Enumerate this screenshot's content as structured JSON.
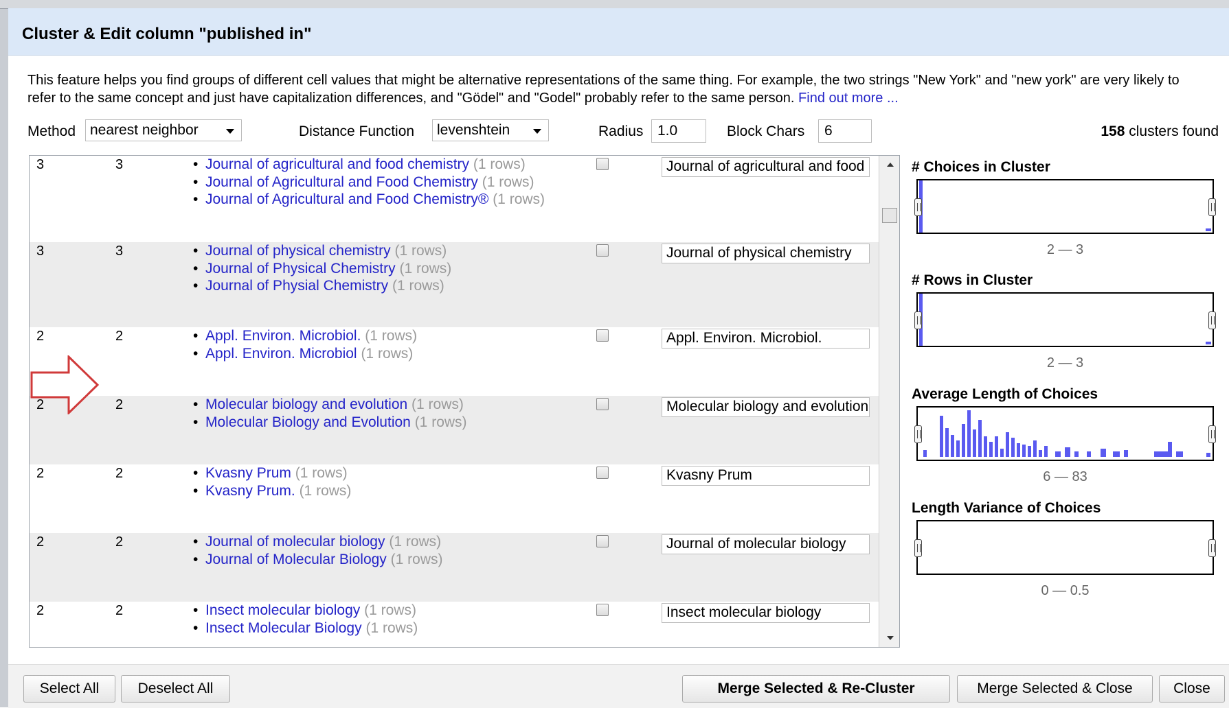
{
  "dialog": {
    "title": "Cluster & Edit column \"published in\"",
    "description": "This feature helps you find groups of different cell values that might be alternative representations of the same thing. For example, the two strings \"New York\" and \"new york\" are very likely to refer to the same concept and just have capitalization differences, and \"Gödel\" and \"Godel\" probably refer to the same person.",
    "find_out_more": "Find out more ..."
  },
  "controls": {
    "method_label": "Method",
    "method_value": "nearest neighbor",
    "distance_label": "Distance Function",
    "distance_value": "levenshtein",
    "radius_label": "Radius",
    "radius_value": "1.0",
    "block_chars_label": "Block Chars",
    "block_chars_value": "6",
    "clusters_count": "158",
    "clusters_suffix": " clusters found"
  },
  "clusters": [
    {
      "size": "3",
      "rows": "3",
      "values": [
        {
          "text": "Journal of agricultural and food chemistry",
          "count": "(1 rows)"
        },
        {
          "text": "Journal of Agricultural and Food Chemistry",
          "count": "(1 rows)"
        },
        {
          "text": "Journal of Agricultural and Food Chemistry®",
          "count": "(1 rows)"
        }
      ],
      "new_value": "Journal of agricultural and food chemistry"
    },
    {
      "size": "3",
      "rows": "3",
      "values": [
        {
          "text": "Journal of physical chemistry",
          "count": "(1 rows)"
        },
        {
          "text": "Journal of Physical Chemistry",
          "count": "(1 rows)"
        },
        {
          "text": "Journal of Physial Chemistry",
          "count": "(1 rows)"
        }
      ],
      "new_value": "Journal of physical chemistry"
    },
    {
      "size": "2",
      "rows": "2",
      "values": [
        {
          "text": "Appl. Environ. Microbiol.",
          "count": "(1 rows)"
        },
        {
          "text": "Appl. Environ. Microbiol",
          "count": "(1 rows)"
        }
      ],
      "new_value": "Appl. Environ. Microbiol."
    },
    {
      "size": "2",
      "rows": "2",
      "values": [
        {
          "text": "Molecular biology and evolution",
          "count": "(1 rows)"
        },
        {
          "text": "Molecular Biology and Evolution",
          "count": "(1 rows)"
        }
      ],
      "new_value": "Molecular biology and evolution"
    },
    {
      "size": "2",
      "rows": "2",
      "values": [
        {
          "text": "Kvasny Prum",
          "count": "(1 rows)"
        },
        {
          "text": "Kvasny Prum.",
          "count": "(1 rows)"
        }
      ],
      "new_value": "Kvasny Prum"
    },
    {
      "size": "2",
      "rows": "2",
      "values": [
        {
          "text": "Journal of molecular biology",
          "count": "(1 rows)"
        },
        {
          "text": "Journal of Molecular Biology",
          "count": "(1 rows)"
        }
      ],
      "new_value": "Journal of molecular biology"
    },
    {
      "size": "2",
      "rows": "2",
      "values": [
        {
          "text": "Insect molecular biology",
          "count": "(1 rows)"
        },
        {
          "text": "Insect Molecular Biology",
          "count": "(1 rows)"
        }
      ],
      "new_value": "Insect molecular biology"
    }
  ],
  "facets": [
    {
      "title": "# Choices in Cluster",
      "range": "2 — 3"
    },
    {
      "title": "# Rows in Cluster",
      "range": "2 — 3"
    },
    {
      "title": "Average Length of Choices",
      "range": "6 — 83"
    },
    {
      "title": "Length Variance of Choices",
      "range": "0 — 0.5"
    }
  ],
  "buttons": {
    "select_all": "Select All",
    "deselect_all": "Deselect All",
    "merge_recluster": "Merge Selected & Re-Cluster",
    "merge_close": "Merge Selected & Close",
    "close": "Close"
  },
  "colors": {
    "link": "#2424c8",
    "histogram": "#5a5af0",
    "arrow": "#d03a3a"
  },
  "icons": {
    "dropdown": "triangle-down",
    "arrow": "right-arrow-outline"
  }
}
